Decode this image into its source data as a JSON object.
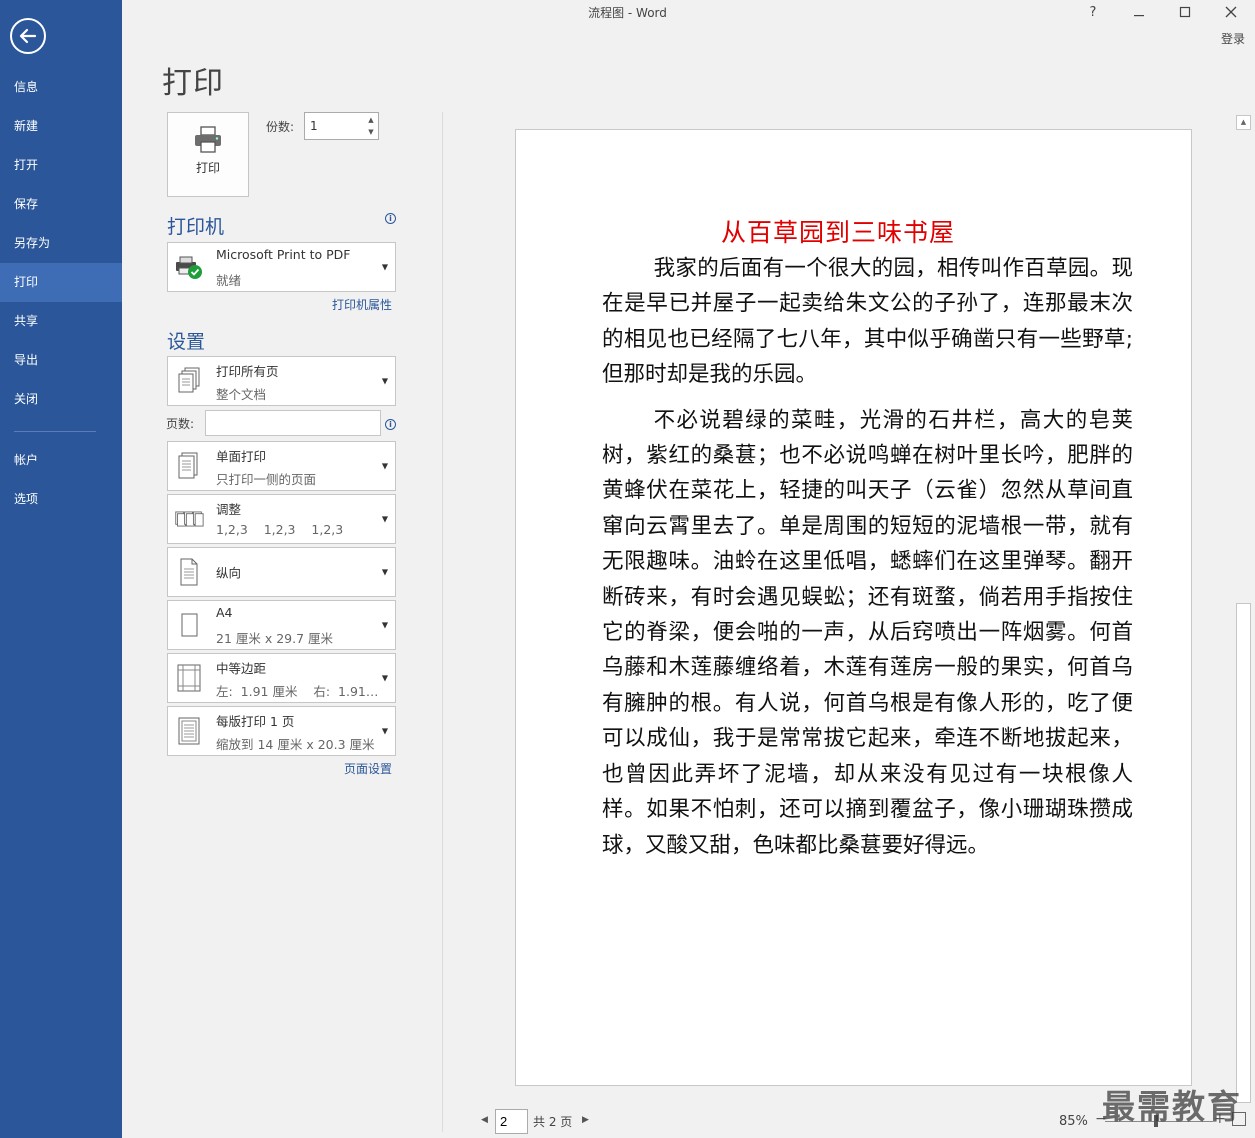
{
  "window": {
    "title": "流程图 - Word",
    "help": "?",
    "login": "登录"
  },
  "sidebar": {
    "items": [
      {
        "label": "信息"
      },
      {
        "label": "新建"
      },
      {
        "label": "打开"
      },
      {
        "label": "保存"
      },
      {
        "label": "另存为"
      },
      {
        "label": "打印",
        "active": true
      },
      {
        "label": "共享"
      },
      {
        "label": "导出"
      },
      {
        "label": "关闭"
      },
      {
        "label": "帐户"
      },
      {
        "label": "选项"
      }
    ]
  },
  "print": {
    "title": "打印",
    "button_label": "打印",
    "copies_label": "份数:",
    "copies_value": "1"
  },
  "printer": {
    "section_title": "打印机",
    "name": "Microsoft Print to PDF",
    "status": "就绪",
    "properties_link": "打印机属性"
  },
  "settings": {
    "section_title": "设置",
    "range": {
      "line1": "打印所有页",
      "line2": "整个文档"
    },
    "pages_label": "页数:",
    "pages_value": "",
    "sides": {
      "line1": "单面打印",
      "line2": "只打印一侧的页面"
    },
    "collate": {
      "line1": "调整",
      "line2": "1,2,3    1,2,3    1,2,3"
    },
    "orientation": {
      "line1": "纵向"
    },
    "paper": {
      "line1": "A4",
      "line2": "21 厘米 x 29.7 厘米"
    },
    "margins": {
      "line1": "中等边距",
      "line2": "左:  1.91 厘米    右:  1.91…"
    },
    "per_sheet": {
      "line1": "每版打印 1 页",
      "line2": "缩放到 14 厘米 x 20.3 厘米"
    },
    "page_setup_link": "页面设置"
  },
  "preview": {
    "doc_title": "从百草园到三味书屋",
    "paragraphs": [
      "我家的后面有一个很大的园，相传叫作百草园。现在是早已并屋子一起卖给朱文公的子孙了，连那最末次的相见也已经隔了七八年，其中似乎确凿只有一些野草;但那时却是我的乐园。",
      "不必说碧绿的菜畦，光滑的石井栏，高大的皂荚树，紫红的桑葚；也不必说鸣蝉在树叶里长吟，肥胖的黄蜂伏在菜花上，轻捷的叫天子（云雀）忽然从草间直窜向云霄里去了。单是周围的短短的泥墙根一带，就有无限趣味。油蛉在这里低唱，蟋蟀们在这里弹琴。翻开断砖来，有时会遇见蜈蚣；还有斑蝥，倘若用手指按住它的脊梁，便会啪的一声，从后窍喷出一阵烟雾。何首乌藤和木莲藤缠络着，木莲有莲房一般的果实，何首乌有臃肿的根。有人说，何首乌根是有像人形的，吃了便可以成仙，我于是常常拔它起来，牵连不断地拔起来，也曾因此弄坏了泥墙，却从来没有见过有一块根像人样。如果不怕刺，还可以摘到覆盆子，像小珊瑚珠攒成球，又酸又甜，色味都比桑葚要好得远。"
    ],
    "title_color": "#e00000"
  },
  "footer": {
    "current_page": "2",
    "total_pages": "共 2 页",
    "zoom": "85%",
    "zoom_percent": 85
  },
  "watermark": "最需教育",
  "colors": {
    "sidebar": "#2b579a",
    "sidebar_active": "#3e6db5",
    "accent": "#2b579a"
  }
}
